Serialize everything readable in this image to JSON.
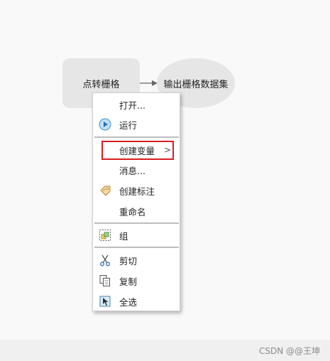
{
  "canvas": {
    "tool_node_label": "点转栅格",
    "output_node_label": "输出栅格数据集"
  },
  "context_menu": {
    "items": [
      {
        "label": "打开...",
        "icon": ""
      },
      {
        "label": "运行",
        "icon": "run-icon"
      },
      {
        "label": "创建变量",
        "icon": "",
        "submenu_arrow": ">"
      },
      {
        "label": "消息...",
        "icon": ""
      },
      {
        "label": "创建标注",
        "icon": "tag-label-icon"
      },
      {
        "label": "重命名",
        "icon": ""
      },
      {
        "label": "组",
        "icon": "group-icon"
      },
      {
        "label": "剪切",
        "icon": "scissors-icon"
      },
      {
        "label": "复制",
        "icon": "copy-icon"
      },
      {
        "label": "全选",
        "icon": "select-all-icon"
      }
    ]
  },
  "highlight_color": "#d91e1e",
  "watermark": "CSDN @@王坤"
}
